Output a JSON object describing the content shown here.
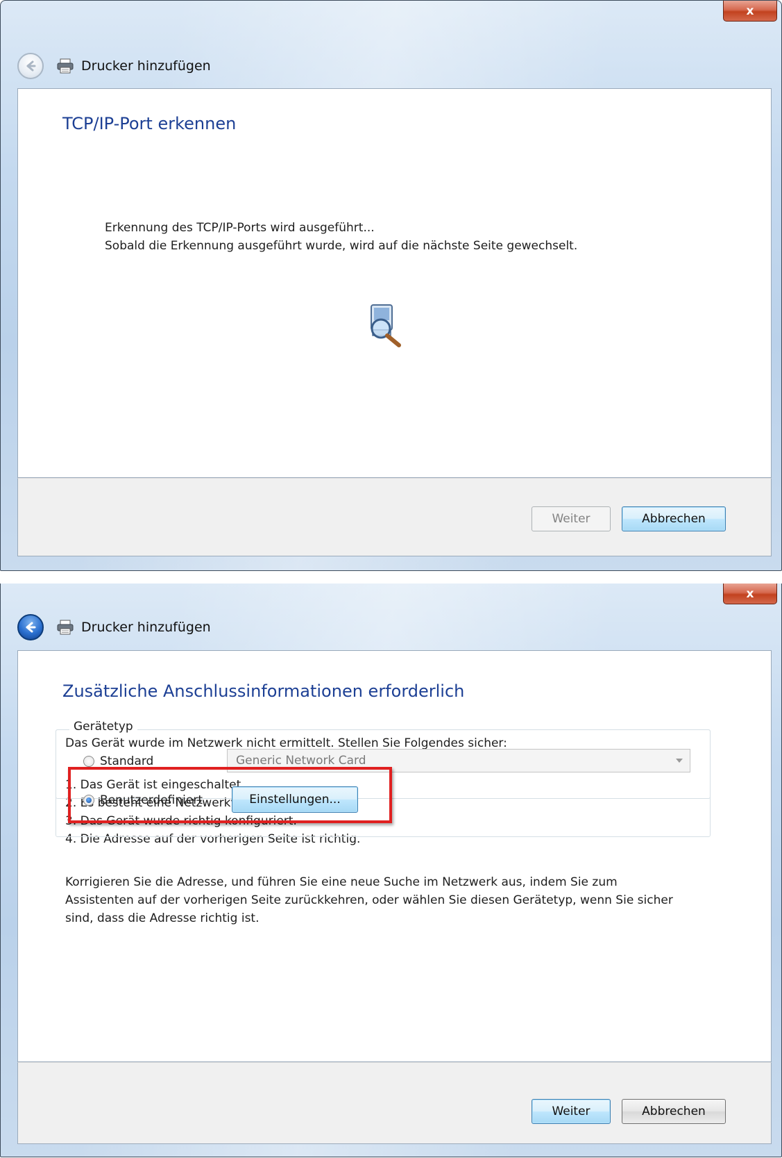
{
  "window1": {
    "close_label": "x",
    "title": "Drucker hinzufügen",
    "heading": "TCP/IP-Port erkennen",
    "status_line1": "Erkennung des TCP/IP-Ports wird ausgeführt...",
    "status_line2": "Sobald die Erkennung ausgeführt wurde, wird auf die nächste Seite gewechselt.",
    "next_label": "Weiter",
    "cancel_label": "Abbrechen"
  },
  "window2": {
    "close_label": "x",
    "title": "Drucker hinzufügen",
    "heading": "Zusätzliche Anschlussinformationen erforderlich",
    "intro": "Das Gerät wurde im Netzwerk nicht ermittelt. Stellen Sie Folgendes sicher:",
    "checklist": [
      "1. Das Gerät ist eingeschaltet.",
      "2. Es besteht eine Netzwerkverbindung.",
      "3. Das Gerät wurde richtig konfiguriert.",
      "4. Die Adresse auf der vorherigen Seite ist richtig."
    ],
    "advice_line1": "Korrigieren Sie die Adresse, und führen Sie eine neue Suche im Netzwerk aus, indem Sie zum",
    "advice_line2": "Assistenten auf der vorherigen Seite zurückkehren, oder wählen Sie diesen Gerätetyp, wenn Sie sicher",
    "advice_line3": "sind, dass die Adresse richtig ist.",
    "device_type_legend": "Gerätetyp",
    "radio_standard_label": "Standard",
    "standard_select_value": "Generic Network Card",
    "radio_custom_label": "Benutzerdefiniert",
    "settings_button_label": "Einstellungen...",
    "selected_device_type": "Benutzerdefiniert",
    "next_label": "Weiter",
    "cancel_label": "Abbrechen"
  },
  "colors": {
    "heading": "#1c3f94",
    "highlight": "#e02020",
    "default_button_border": "#3c7fb1"
  }
}
